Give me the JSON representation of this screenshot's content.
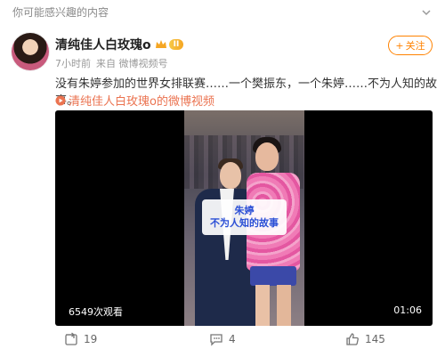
{
  "header": {
    "hint": "你可能感兴趣的内容"
  },
  "post": {
    "author": "清纯佳人白玫瑰o",
    "vip_level": "II",
    "time": "7小时前",
    "source": "来自 微博视频号",
    "follow_label": "关注",
    "text": "没有朱婷参加的世界女排联赛……一个樊振东，一个朱婷……不为人知的故事。",
    "video_link": "清纯佳人白玫瑰o的微博视频"
  },
  "video": {
    "caption_line1": "朱婷",
    "caption_line2": "不为人知的故事",
    "views": "6549次观看",
    "duration": "01:06"
  },
  "actions": {
    "repost_count": "19",
    "comment_count": "4",
    "like_count": "145"
  },
  "colors": {
    "accent": "#ff8200",
    "link": "#eb7350",
    "caption_text": "#2b4fd6"
  }
}
